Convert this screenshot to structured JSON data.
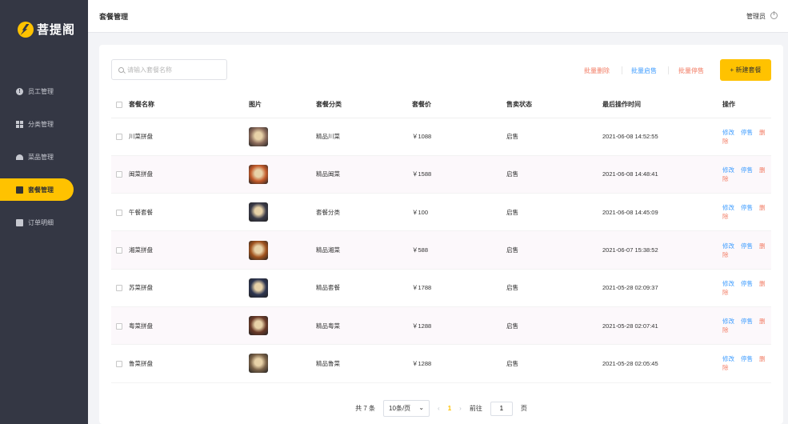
{
  "sidebar": {
    "logo_text": "菩提阁",
    "items": [
      {
        "label": "员工管理",
        "icon": "info-icon",
        "active": false
      },
      {
        "label": "分类管理",
        "icon": "grid-icon",
        "active": false
      },
      {
        "label": "菜品管理",
        "icon": "dish-icon",
        "active": false
      },
      {
        "label": "套餐管理",
        "icon": "gift-icon",
        "active": true
      },
      {
        "label": "订单明细",
        "icon": "clipboard-icon",
        "active": false
      }
    ]
  },
  "header": {
    "title": "套餐管理",
    "user": "管理员",
    "logout_icon": "power-icon"
  },
  "toolbar": {
    "search_placeholder": "请输入套餐名称",
    "batch_delete": "批量删除",
    "batch_enable": "批量启售",
    "batch_disable": "批量停售",
    "add_label": "+ 新建套餐"
  },
  "table": {
    "headers": [
      "套餐名称",
      "图片",
      "套餐分类",
      "套餐价",
      "售卖状态",
      "最后操作时间",
      "操作"
    ],
    "actions": {
      "edit": "修改",
      "stop": "停售",
      "delete": "删除"
    },
    "rows": [
      {
        "name": "川菜拼盘",
        "category": "精品川菜",
        "price": "￥1088",
        "status": "启售",
        "time": "2021-06-08 14:52:55",
        "thumb": "#8a6a5a"
      },
      {
        "name": "闽菜拼盘",
        "category": "精品闽菜",
        "price": "￥1588",
        "status": "启售",
        "time": "2021-06-08 14:48:41",
        "thumb": "#c25a2a"
      },
      {
        "name": "午餐套餐",
        "category": "套餐分类",
        "price": "￥100",
        "status": "启售",
        "time": "2021-06-08 14:45:09",
        "thumb": "#3a3a48"
      },
      {
        "name": "湘菜拼盘",
        "category": "精品湘菜",
        "price": "￥588",
        "status": "启售",
        "time": "2021-06-07 15:38:52",
        "thumb": "#a0521e"
      },
      {
        "name": "苏菜拼盘",
        "category": "精品套餐",
        "price": "￥1788",
        "status": "启售",
        "time": "2021-05-28 02:09:37",
        "thumb": "#2d3550"
      },
      {
        "name": "粤菜拼盘",
        "category": "精品粤菜",
        "price": "￥1288",
        "status": "启售",
        "time": "2021-05-28 02:07:41",
        "thumb": "#6a3a28"
      },
      {
        "name": "鲁菜拼盘",
        "category": "精品鲁菜",
        "price": "￥1288",
        "status": "启售",
        "time": "2021-05-28 02:05:45",
        "thumb": "#7a6248"
      }
    ]
  },
  "pagination": {
    "total": "共 7 条",
    "page_size": "10条/页",
    "current": "1",
    "goto_label": "前往",
    "goto_value": "1",
    "page_suffix": "页"
  },
  "colors": {
    "accent": "#ffc200",
    "sidebar": "#343744",
    "link": "#419eff",
    "danger": "#f27c64"
  }
}
